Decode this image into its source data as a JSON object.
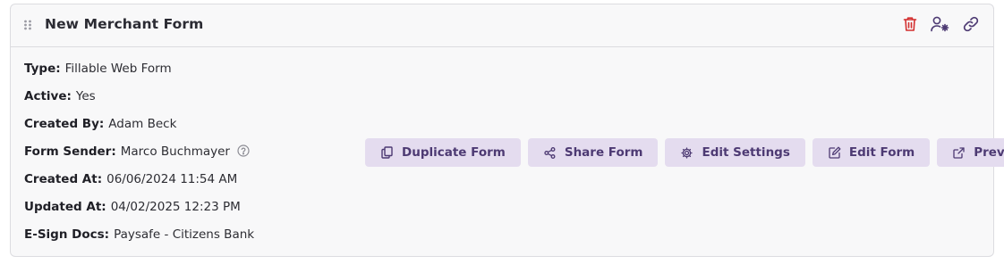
{
  "form": {
    "title": "New Merchant Form",
    "fields": [
      {
        "label": "Type:",
        "value": "Fillable Web Form"
      },
      {
        "label": "Active:",
        "value": "Yes"
      },
      {
        "label": "Created By:",
        "value": "Adam Beck"
      },
      {
        "label": "Form Sender:",
        "value": "Marco Buchmayer"
      },
      {
        "label": "Created At:",
        "value": "06/06/2024 11:54 AM"
      },
      {
        "label": "Updated At:",
        "value": "04/02/2025 12:23 PM"
      },
      {
        "label": "E-Sign Docs:",
        "value": "Paysafe - Citizens Bank"
      }
    ]
  },
  "header_icons": [
    "trash-icon",
    "user-gear-icon",
    "link-icon"
  ],
  "actions": [
    {
      "label": "Duplicate Form",
      "icon": "copy-icon"
    },
    {
      "label": "Share Form",
      "icon": "share-icon"
    },
    {
      "label": "Edit Settings",
      "icon": "gear-icon"
    },
    {
      "label": "Edit Form",
      "icon": "edit-icon"
    },
    {
      "label": "Preview",
      "icon": "external-link-icon"
    }
  ],
  "colors": {
    "accent": "#4d3a73",
    "button_bg": "#e4dcef",
    "danger": "#d32f2f",
    "card_bg": "#f8f8f9",
    "border": "#dcdce0"
  }
}
